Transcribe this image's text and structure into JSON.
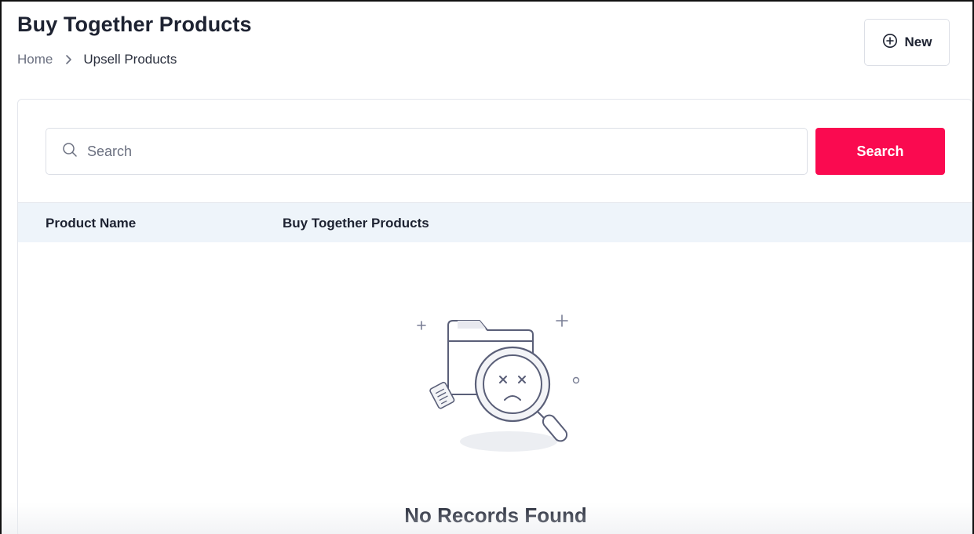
{
  "header": {
    "title": "Buy Together Products",
    "breadcrumb": {
      "home": "Home",
      "current": "Upsell Products"
    },
    "new_button_label": "New"
  },
  "search": {
    "placeholder": "Search",
    "value": "",
    "button_label": "Search"
  },
  "table": {
    "columns": [
      "Product Name",
      "Buy Together Products"
    ],
    "rows": [],
    "empty_message": "No Records Found"
  },
  "icons": {
    "breadcrumb_separator": "chevron-right-icon",
    "new_button": "plus-circle-icon",
    "search_field": "search-icon",
    "empty_state": "no-records-illustration"
  },
  "colors": {
    "accent": "#fa0a50",
    "table_header_bg": "#eef4fa",
    "text_primary": "#1d2231",
    "text_muted": "#6b7080"
  }
}
